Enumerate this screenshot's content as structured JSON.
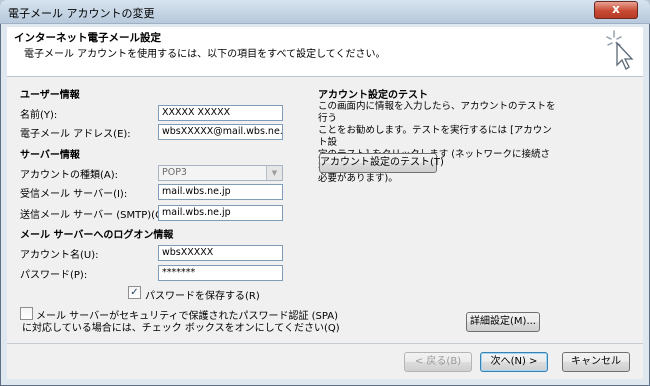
{
  "window": {
    "title": "電子メール アカウントの変更",
    "close_label": "x"
  },
  "header": {
    "title": "インターネット電子メール設定",
    "subtitle": "電子メール アカウントを使用するには、以下の項目をすべて設定してください。"
  },
  "user_info": {
    "heading": "ユーザー情報",
    "name_label": "名前(Y):",
    "name_value": "XXXXX XXXXX",
    "email_label": "電子メール アドレス(E):",
    "email_value": "wbsXXXXX@mail.wbs.ne.jp"
  },
  "server_info": {
    "heading": "サーバー情報",
    "account_type_label": "アカウントの種類(A):",
    "account_type_value": "POP3",
    "incoming_label": "受信メール サーバー(I):",
    "incoming_value": "mail.wbs.ne.jp",
    "outgoing_label": "送信メール サーバー (SMTP)(O):",
    "outgoing_value": "mail.wbs.ne.jp"
  },
  "logon_info": {
    "heading": "メール サーバーへのログオン情報",
    "account_name_label": "アカウント名(U):",
    "account_name_value": "wbsXXXXX",
    "password_label": "パスワード(P):",
    "password_value": "*******",
    "remember_label": "パスワードを保存する(R)",
    "remember_checked": true,
    "spa_label_line1": "メール サーバーがセキュリティで保護されたパスワード認証 (SPA)",
    "spa_label_line2": "に対応している場合には、チェック ボックスをオンにしてください(Q)",
    "spa_checked": false
  },
  "test": {
    "heading": "アカウント設定のテスト",
    "desc_line1": "この画面内に情報を入力したら、アカウントのテストを行う",
    "desc_line2": "ことをお勧めします。テストを実行するには [アカウント設",
    "desc_line3": "定のテスト] をクリックします (ネットワークに接続されている",
    "desc_line4": "必要があります)。",
    "test_button": "アカウント設定のテスト(T)"
  },
  "buttons": {
    "more_settings": "詳細設定(M)...",
    "back": "< 戻る(B)",
    "next": "次へ(N) >",
    "cancel": "キャンセル"
  },
  "icons": {
    "header": "cursor-sparkle-icon",
    "check": "checkmark-icon"
  }
}
